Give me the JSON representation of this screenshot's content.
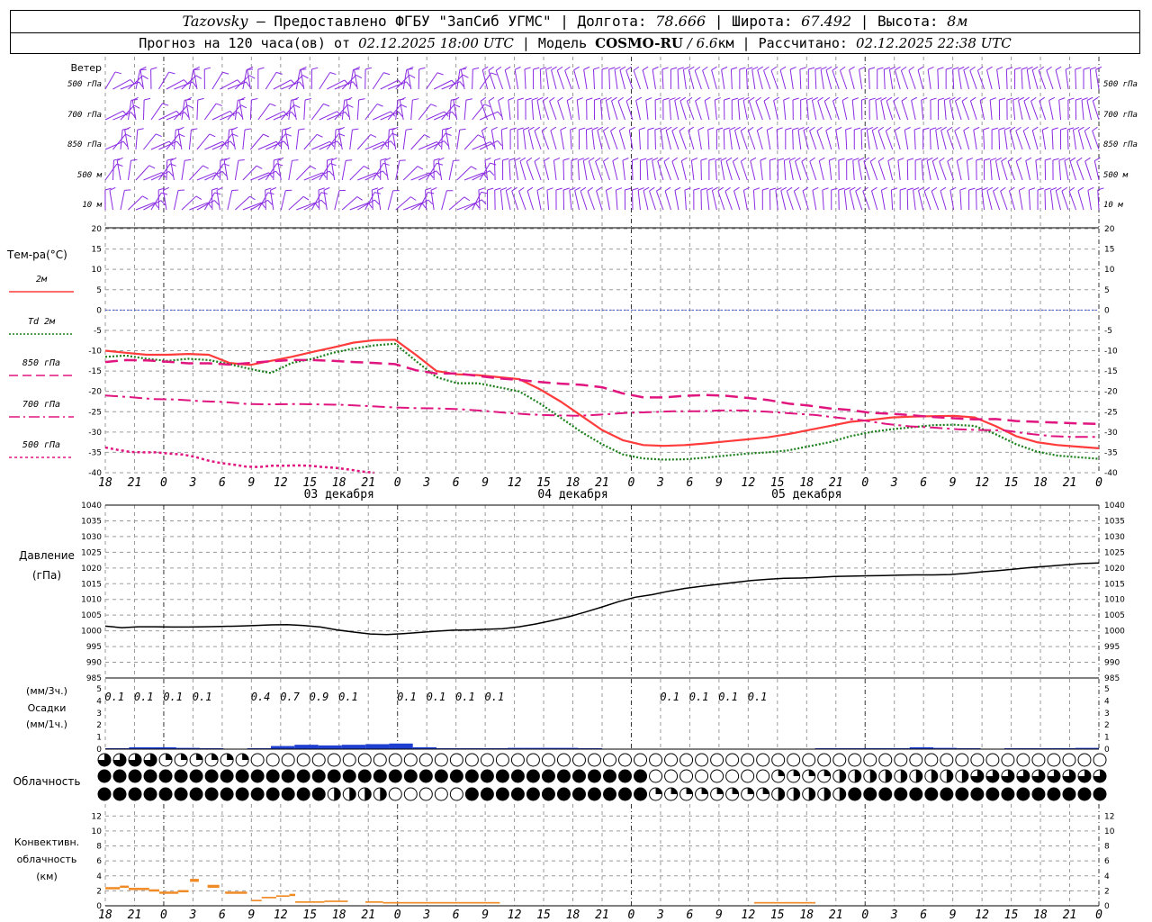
{
  "header": {
    "station": "Tazovsky",
    "provider": " — Предоставлено ФГБУ \"ЗапСиб УГМС\" | Долгота: ",
    "lon": "78.666",
    "lat_label": " | Широта: ",
    "lat": "67.492",
    "alt_label": " | Высота: ",
    "alt": "8м",
    "line2_a": "Прогноз на 120 часа(ов) от ",
    "init_time": "02.12.2025 18:00 UTC",
    "line2_b": "  | Модель ",
    "model": "COSMO-RU",
    "model_res": " / 6.6",
    "model_unit": "км",
    "line2_c": " | Рассчитано: ",
    "calc_time": "02.12.2025 22:38 UTC"
  },
  "time_axis": {
    "hour_labels": [
      "18",
      "21",
      "0",
      "3",
      "6",
      "9",
      "12",
      "15",
      "18",
      "21",
      "0",
      "3",
      "6",
      "9",
      "12",
      "15",
      "18",
      "21",
      "0",
      "3",
      "6",
      "9",
      "12",
      "15",
      "18",
      "21",
      "0",
      "3",
      "6",
      "9",
      "12",
      "15",
      "18",
      "21",
      "0"
    ],
    "day_labels": [
      {
        "text": "03 декабря",
        "index": 8
      },
      {
        "text": "04 декабря",
        "index": 16
      },
      {
        "text": "05 декабря",
        "index": 24
      }
    ]
  },
  "wind_panel": {
    "title": "Ветер",
    "levels": [
      "500 гПа",
      "700 гПа",
      "850 гПа",
      "500 м",
      "10  м"
    ],
    "color": "#8a2be2"
  },
  "temp_panel": {
    "title": "Тем-ра(°С)",
    "legend": [
      {
        "label": "2м",
        "color": "#ff3b3b",
        "style": "solid"
      },
      {
        "label": "Td  2м",
        "color": "#1a7f1a",
        "style": "dotted"
      },
      {
        "label": "850 гПа",
        "color": "#e0157f",
        "style": "dash"
      },
      {
        "label": "700 гПа",
        "color": "#e0157f",
        "style": "dashdot"
      },
      {
        "label": "500 гПа",
        "color": "#e0157f",
        "style": "dot"
      }
    ],
    "y_ticks": [
      "20",
      "15",
      "10",
      "5",
      "0",
      "-5",
      "-10",
      "-15",
      "-20",
      "-25",
      "-30",
      "-35",
      "-40"
    ]
  },
  "pressure_panel": {
    "title": "Давление",
    "unit": "(гПа)",
    "y_ticks": [
      "1040",
      "1035",
      "1030",
      "1025",
      "1020",
      "1015",
      "1010",
      "1005",
      "1000",
      "995",
      "990",
      "985"
    ]
  },
  "precip_panel": {
    "unit3": "(мм/3ч.)",
    "title": "Осадки",
    "unit1": "(мм/1ч.)",
    "y_ticks": [
      "5",
      "4",
      "3",
      "2",
      "1",
      "0"
    ],
    "labels_3h": [
      {
        "index": 0.5,
        "text": "0.1"
      },
      {
        "index": 1.5,
        "text": "0.1"
      },
      {
        "index": 2.5,
        "text": "0.1"
      },
      {
        "index": 3.5,
        "text": "0.1"
      },
      {
        "index": 5.5,
        "text": "0.4"
      },
      {
        "index": 6.5,
        "text": "0.7"
      },
      {
        "index": 7.5,
        "text": "0.9"
      },
      {
        "index": 8.5,
        "text": "0.1"
      },
      {
        "index": 10.5,
        "text": "0.1"
      },
      {
        "index": 11.5,
        "text": "0.1"
      },
      {
        "index": 12.5,
        "text": "0.1"
      },
      {
        "index": 13.5,
        "text": "0.1"
      },
      {
        "index": 19.5,
        "text": "0.1"
      },
      {
        "index": 20.5,
        "text": "0.1"
      },
      {
        "index": 21.5,
        "text": "0.1"
      },
      {
        "index": 22.5,
        "text": "0.1"
      }
    ]
  },
  "cloud_panel": {
    "title": "Облачность"
  },
  "conv_panel": {
    "title1": "Конвективн.",
    "title2": "облачность",
    "unit": "(км)",
    "y_ticks": [
      "12",
      "10",
      "8",
      "6",
      "4",
      "2",
      "0"
    ]
  },
  "chart_data": [
    {
      "type": "line",
      "title": "Тем-ра(°С)",
      "x": [
        0,
        1,
        2,
        3,
        4,
        5,
        6,
        7,
        8,
        9,
        10,
        11,
        12,
        13,
        14,
        15,
        16,
        17,
        18,
        19,
        20,
        21,
        22,
        23,
        24,
        25,
        26,
        27,
        28,
        29,
        30,
        31,
        32,
        33,
        34
      ],
      "x_unit": "3h steps from 02.12.2025 18:00 UTC",
      "ylim": [
        -40,
        20
      ],
      "series": [
        {
          "name": "2м",
          "values": [
            -10,
            -10.5,
            -11,
            -11,
            -10.8,
            -11,
            -13,
            -13.5,
            -12.5,
            -11.5,
            -10.3,
            -9.2,
            -8,
            -7.4,
            -7.3,
            -11,
            -15,
            -15.8,
            -16,
            -16.5,
            -17,
            -19.5,
            -22.5,
            -26,
            -29.5,
            -32,
            -33.2,
            -33.4,
            -33.2,
            -32.8,
            -32.3,
            -31.8,
            -31.3,
            -30.5,
            -29.5,
            -28.5,
            -27.5,
            -27,
            -26.4,
            -26.2,
            -26.1,
            -26,
            -26.4,
            -28.5,
            -31,
            -32.5,
            -33.2,
            -33.6,
            -34
          ]
        },
        {
          "name": "Td  2м",
          "values": [
            -11.5,
            -11.2,
            -12,
            -12.5,
            -12,
            -12.3,
            -13.3,
            -14.5,
            -15.5,
            -13,
            -12,
            -10.5,
            -9.5,
            -8.7,
            -8.3,
            -12.5,
            -16.5,
            -18,
            -18,
            -19,
            -20,
            -23,
            -26.5,
            -30,
            -33,
            -35.5,
            -36.5,
            -36.8,
            -36.7,
            -36.3,
            -35.8,
            -35.3,
            -35,
            -34.5,
            -33.5,
            -32.5,
            -31,
            -30,
            -29.3,
            -28.8,
            -28.3,
            -28.2,
            -28.5,
            -30.5,
            -33,
            -34.8,
            -35.8,
            -36.2,
            -36.6
          ]
        },
        {
          "name": "850 гПа",
          "values": [
            -12.8,
            -12.3,
            -12.4,
            -12.7,
            -13.1,
            -13.1,
            -13.4,
            -13.0,
            -12.6,
            -12.3,
            -12.3,
            -12.5,
            -12.8,
            -13.0,
            -13.3,
            -14.8,
            -15.6,
            -15.6,
            -16.2,
            -16.8,
            -17.2,
            -17.7,
            -18.1,
            -18.4,
            -19.0,
            -20.5,
            -21.5,
            -21.5,
            -21.1,
            -20.9,
            -21.1,
            -21.6,
            -22.1,
            -23.0,
            -23.5,
            -24.2,
            -24.6,
            -25.3,
            -25.5,
            -25.9,
            -26.3,
            -26.6,
            -26.9,
            -26.8,
            -27.3,
            -27.5,
            -27.7,
            -27.9,
            -28.0
          ]
        },
        {
          "name": "700 гПа",
          "values": [
            -21,
            -21.4,
            -21.9,
            -22,
            -22.4,
            -22.6,
            -23.1,
            -23.2,
            -23.1,
            -23.2,
            -23.3,
            -23.6,
            -23.9,
            -24.1,
            -24.2,
            -24.4,
            -24.8,
            -25.3,
            -25.7,
            -25.9,
            -26,
            -25.7,
            -25.3,
            -25.1,
            -24.9,
            -24.9,
            -24.7,
            -24.7,
            -25,
            -25.4,
            -25.8,
            -26.5,
            -27.1,
            -28,
            -28.6,
            -28.9,
            -29.3,
            -29.5,
            -29.6,
            -30.4,
            -31,
            -31.2,
            -31.2
          ]
        },
        {
          "name": "500 гПа",
          "values": [
            -33.8,
            -34.4,
            -34.9,
            -35,
            -35,
            -35.3,
            -35.5,
            -36.1,
            -37,
            -37.6,
            -38,
            -38.5,
            -38.6,
            -38.3,
            -38.3,
            -38.2,
            -38.3,
            -38.6,
            -38.8,
            -39.2,
            -39.7,
            -40
          ]
        }
      ]
    },
    {
      "type": "line",
      "title": "Давление",
      "ylabel": "(гПа)",
      "ylim": [
        985,
        1040
      ],
      "series": [
        {
          "name": "",
          "values": [
            1001.5,
            1001,
            1001.3,
            1001.3,
            1001.2,
            1001.2,
            1001.3,
            1001.4,
            1001.5,
            1001.7,
            1001.9,
            1002.0,
            1001.7,
            1001.2,
            1000.3,
            999.6,
            999.0,
            998.8,
            999.1,
            999.5,
            999.9,
            1000.2,
            1000.3,
            1000.5,
            1000.7,
            1001.3,
            1002.2,
            1003.3,
            1004.5,
            1006.0,
            1007.6,
            1009.3,
            1010.7,
            1011.5,
            1012.6,
            1013.5,
            1014.2,
            1014.8,
            1015.4,
            1016.0,
            1016.4,
            1016.7,
            1016.8,
            1017.0,
            1017.3,
            1017.4,
            1017.5,
            1017.6,
            1017.7,
            1017.8,
            1017.8,
            1017.9,
            1018.3,
            1018.8,
            1019.2,
            1019.7,
            1020.2,
            1020.6,
            1021.0,
            1021.4,
            1021.6
          ]
        }
      ]
    },
    {
      "type": "bar",
      "title": "Осадки",
      "ylabel": "(мм/1ч.)",
      "ylim": [
        0,
        5
      ],
      "values_1h_by_3h": [
        0.02,
        0.15,
        0.15,
        0.1,
        0.05,
        0.0,
        0.05,
        0.25,
        0.35,
        0.3,
        0.35,
        0.4,
        0.45,
        0.15,
        0.02,
        0.05,
        0.05,
        0.1,
        0.1,
        0.1,
        0.02,
        0,
        0,
        0,
        0,
        0,
        0,
        0,
        0,
        0,
        0.02,
        0.05,
        0.08,
        0.08,
        0.15,
        0.1,
        0.03,
        0,
        0.02,
        0.05,
        0.08,
        0.1
      ]
    },
    {
      "type": "bar",
      "title": "Конвективн. облачность",
      "ylabel": "(км)",
      "ylim": [
        0,
        13
      ],
      "segments": [
        {
          "from": 0,
          "to": 0.5,
          "base": 2.2,
          "top": 2.5
        },
        {
          "from": 0.5,
          "to": 0.8,
          "base": 2.4,
          "top": 2.7
        },
        {
          "from": 0.8,
          "to": 1.5,
          "base": 2.1,
          "top": 2.4
        },
        {
          "from": 1.5,
          "to": 1.85,
          "base": 1.9,
          "top": 2.2
        },
        {
          "from": 1.85,
          "to": 2.5,
          "base": 1.6,
          "top": 1.9
        },
        {
          "from": 2.5,
          "to": 2.85,
          "base": 1.8,
          "top": 2.1
        },
        {
          "from": 2.9,
          "to": 3.2,
          "base": 3.2,
          "top": 3.6
        },
        {
          "from": 3.5,
          "to": 3.9,
          "base": 2.4,
          "top": 2.8
        },
        {
          "from": 4.1,
          "to": 4.85,
          "base": 1.6,
          "top": 1.9
        },
        {
          "from": 5.0,
          "to": 5.35,
          "base": 0.6,
          "top": 0.8
        },
        {
          "from": 5.35,
          "to": 5.85,
          "base": 1.0,
          "top": 1.2
        },
        {
          "from": 5.85,
          "to": 6.3,
          "base": 1.2,
          "top": 1.4
        },
        {
          "from": 6.3,
          "to": 6.5,
          "base": 1.3,
          "top": 1.6
        },
        {
          "from": 6.5,
          "to": 7.5,
          "base": 0.4,
          "top": 0.6
        },
        {
          "from": 7.5,
          "to": 8.3,
          "base": 0.5,
          "top": 0.7
        },
        {
          "from": 8.9,
          "to": 9.5,
          "base": 0.4,
          "top": 0.6
        },
        {
          "from": 9.5,
          "to": 13.5,
          "base": 0.3,
          "top": 0.5
        },
        {
          "from": 22.2,
          "to": 24.3,
          "base": 0.3,
          "top": 0.5
        }
      ]
    }
  ]
}
